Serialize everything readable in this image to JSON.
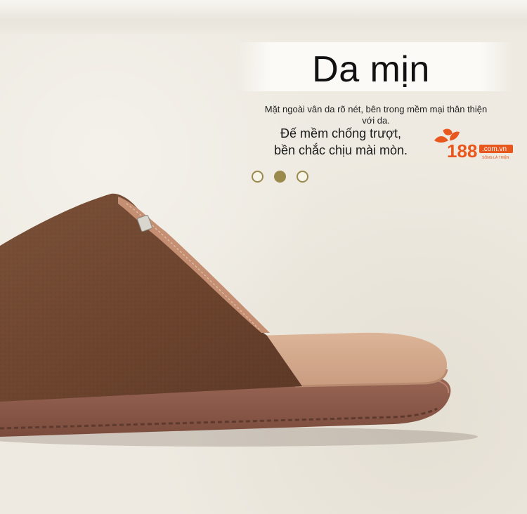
{
  "heading": {
    "title": "Da mịn",
    "description": "Mặt ngoài vân da rõ nét, bên trong mềm mại thân thiện với da.",
    "feature_line_1": "Đế mềm chống trượt,",
    "feature_line_2": "bền chắc chịu mài mòn."
  },
  "brand": {
    "number": "188",
    "domain": ".com.vn",
    "tagline": "SỐNG LÀ THIỆN",
    "color": "#e8571d"
  },
  "carousel": {
    "slide_count": 3,
    "active_index": 1,
    "accent_color": "#9a8a4c"
  },
  "product": {
    "upper_color": "#6e4630",
    "insole_color": "#d8ad8f",
    "sole_color": "#8a5a4a"
  }
}
